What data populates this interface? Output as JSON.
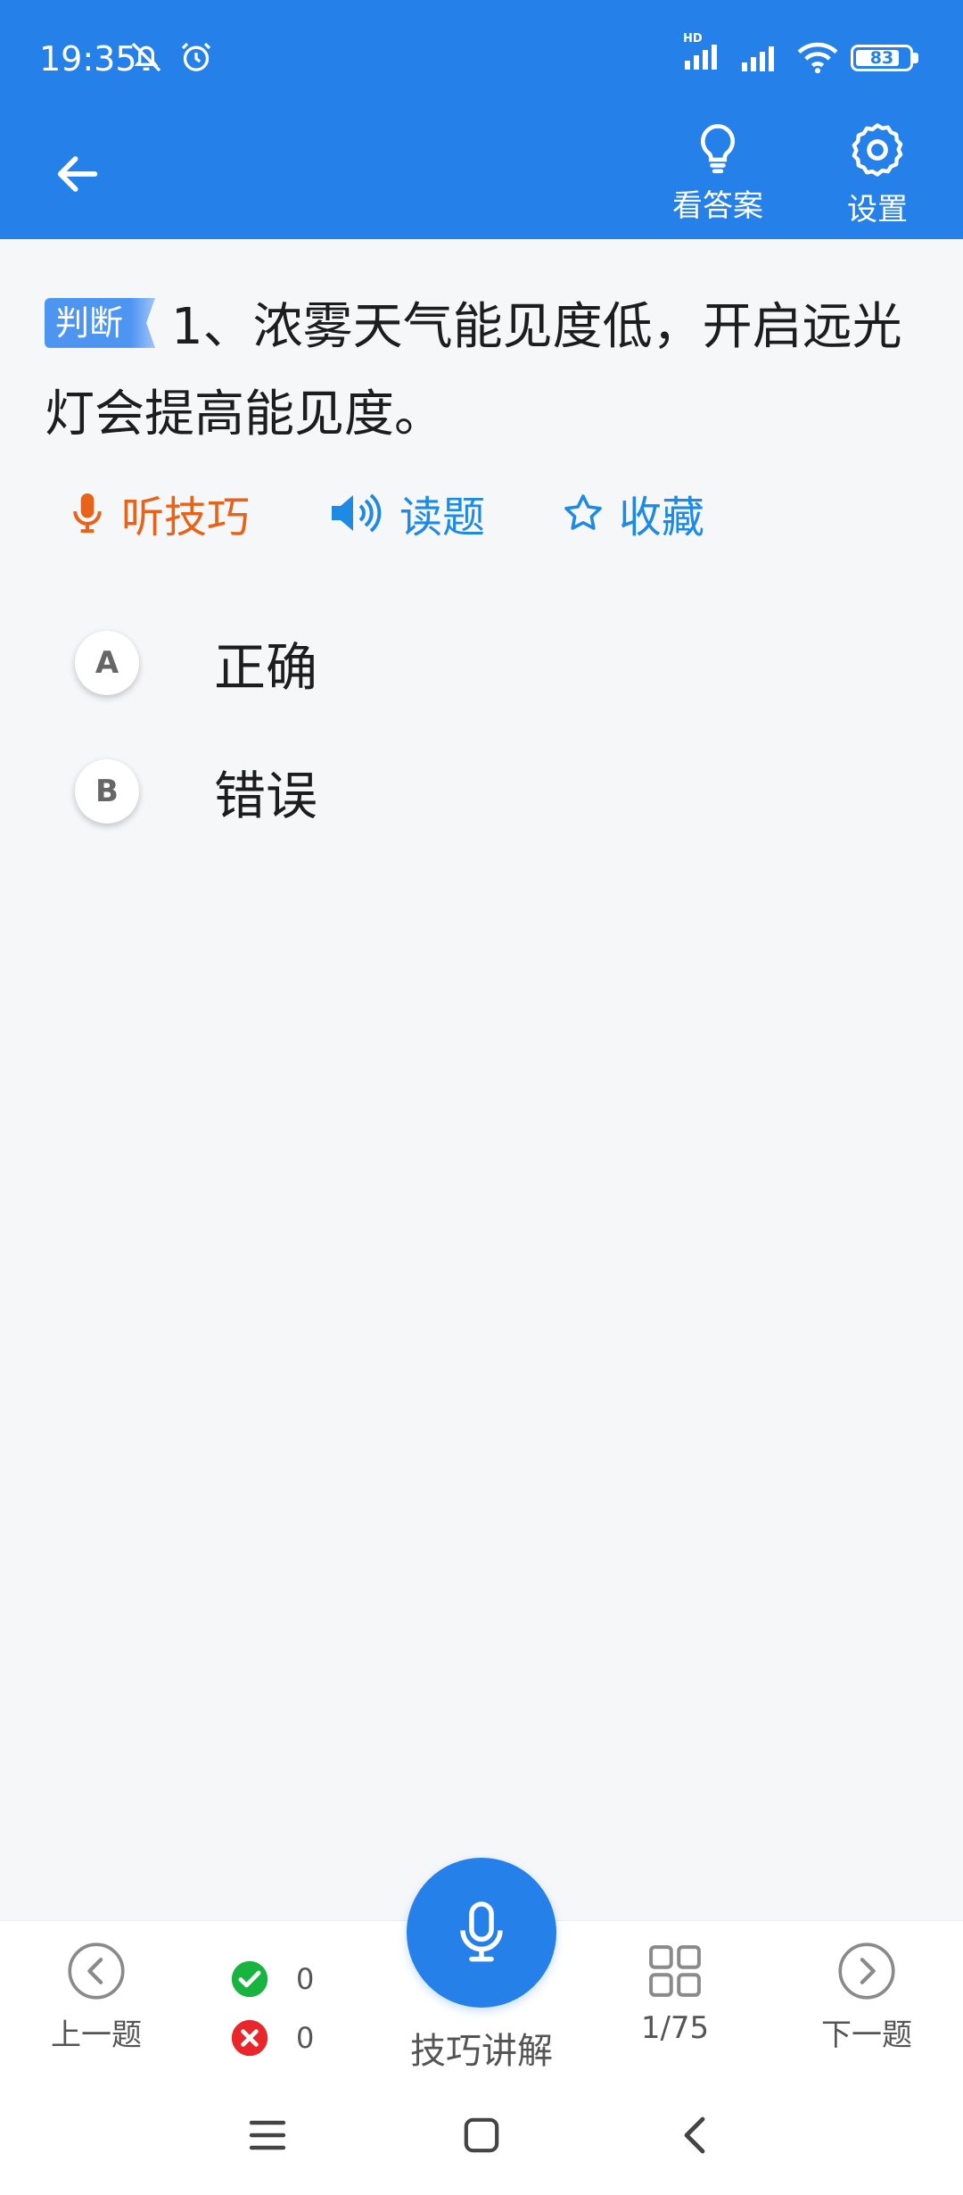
{
  "status_bar": {
    "time": "19:35",
    "battery": "83",
    "battery_level": 0.83,
    "network_label": "HD"
  },
  "header": {
    "show_answer_label": "看答案",
    "settings_label": "设置"
  },
  "question": {
    "type_badge": "判断",
    "text": "1、浓雾天气能见度低，开启远光灯会提高能见度。"
  },
  "actions": {
    "tips_label": "听技巧",
    "read_label": "读题",
    "favorite_label": "收藏"
  },
  "options": [
    {
      "letter": "A",
      "text": "正确"
    },
    {
      "letter": "B",
      "text": "错误"
    }
  ],
  "bottom_bar": {
    "prev_label": "上一题",
    "correct_count": "0",
    "wrong_count": "0",
    "fab_label": "技巧讲解",
    "progress": "1/75",
    "next_label": "下一题"
  },
  "colors": {
    "primary": "#2680ea",
    "tips_orange": "#e8621a",
    "link_blue": "#1f8ae4",
    "correct_green": "#19b33f",
    "wrong_red": "#e8262b"
  },
  "icons": {
    "back": "arrow-left-icon",
    "show_answer": "lightbulb-icon",
    "settings": "gear-icon",
    "tips": "microphone-icon",
    "read": "speaker-icon",
    "favorite": "star-icon",
    "prev": "chevron-left-circle-icon",
    "next": "chevron-right-circle-icon",
    "grid": "grid-icon"
  }
}
